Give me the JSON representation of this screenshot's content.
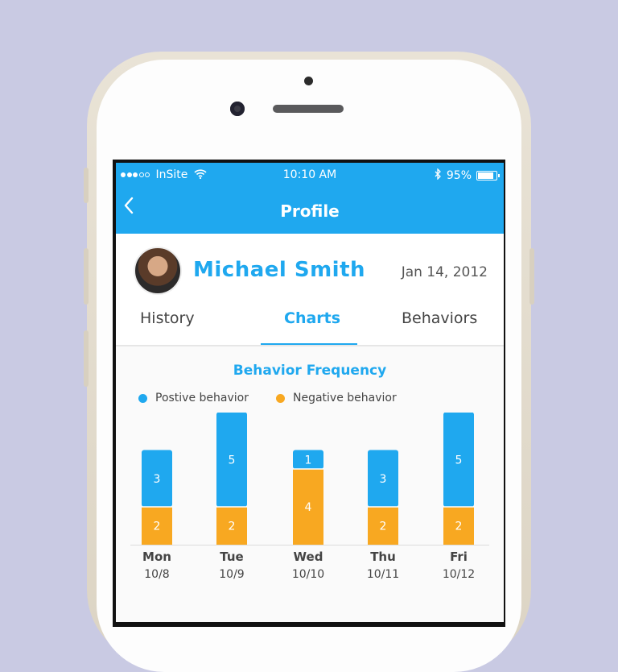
{
  "status_bar": {
    "signal_dots_on": 3,
    "signal_dots_total": 5,
    "carrier": "InSite",
    "wifi_icon": "wifi-icon",
    "time": "10:10 AM",
    "bluetooth_icon": "bluetooth-icon",
    "battery_percent_label": "95%",
    "battery_level": 0.95
  },
  "navbar": {
    "back_icon": "chevron-left-icon",
    "back_glyph": "‹",
    "title": "Profile"
  },
  "profile": {
    "name": "Michael Smith",
    "date": "Jan 14, 2012"
  },
  "tabs": [
    {
      "label": "History",
      "active": false
    },
    {
      "label": "Charts",
      "active": true
    },
    {
      "label": "Behaviors",
      "active": false
    }
  ],
  "chart_title": "Behavior Frequency",
  "colors": {
    "accent": "#1fa8ef",
    "positive": "#1fa8ef",
    "negative": "#f8a821"
  },
  "chart_data": {
    "type": "bar",
    "stacked": true,
    "title": "Behavior Frequency",
    "categories": [
      "Mon",
      "Tue",
      "Wed",
      "Thu",
      "Fri"
    ],
    "category_dates": [
      "10/8",
      "10/9",
      "10/10",
      "10/11",
      "10/12"
    ],
    "series": [
      {
        "name": "Postive behavior",
        "color": "#1fa8ef",
        "values": [
          3,
          5,
          1,
          3,
          5
        ]
      },
      {
        "name": "Negative behavior",
        "color": "#f8a821",
        "values": [
          2,
          2,
          4,
          2,
          2
        ]
      }
    ],
    "legend_position": "top",
    "grid": false
  }
}
